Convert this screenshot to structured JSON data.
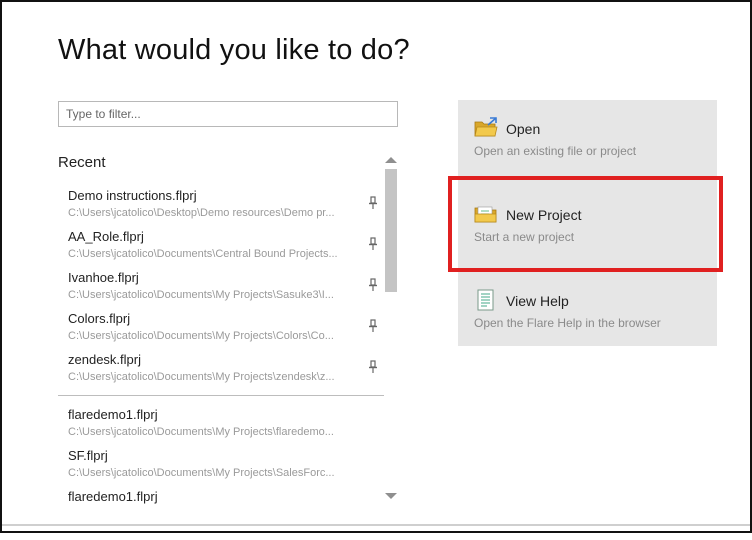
{
  "page": {
    "title": "What would you like to do?"
  },
  "filter": {
    "placeholder": "Type to filter..."
  },
  "recent": {
    "label": "Recent",
    "pinned": [
      {
        "name": "Demo instructions.flprj",
        "path": "C:\\Users\\jcatolico\\Desktop\\Demo resources\\Demo pr..."
      },
      {
        "name": "AA_Role.flprj",
        "path": "C:\\Users\\jcatolico\\Documents\\Central Bound Projects..."
      },
      {
        "name": "Ivanhoe.flprj",
        "path": "C:\\Users\\jcatolico\\Documents\\My Projects\\Sasuke3\\I..."
      },
      {
        "name": "Colors.flprj",
        "path": "C:\\Users\\jcatolico\\Documents\\My Projects\\Colors\\Co..."
      },
      {
        "name": "zendesk.flprj",
        "path": "C:\\Users\\jcatolico\\Documents\\My Projects\\zendesk\\z..."
      }
    ],
    "unpinned": [
      {
        "name": "flaredemo1.flprj",
        "path": "C:\\Users\\jcatolico\\Documents\\My Projects\\flaredemo..."
      },
      {
        "name": "SF.flprj",
        "path": "C:\\Users\\jcatolico\\Documents\\My Projects\\SalesForc..."
      },
      {
        "name": "flaredemo1.flprj",
        "path": ""
      }
    ]
  },
  "actions": {
    "open": {
      "title": "Open",
      "description": "Open an existing file or project",
      "icon": "open-folder-icon"
    },
    "new_project": {
      "title": "New Project",
      "description": "Start a new project",
      "icon": "new-project-folder-icon"
    },
    "view_help": {
      "title": "View Help",
      "description": "Open the Flare Help in the browser",
      "icon": "help-document-icon"
    }
  },
  "colors": {
    "highlight": "#e02020",
    "panel": "#e6e6e6",
    "folder": "#f2c94c"
  }
}
